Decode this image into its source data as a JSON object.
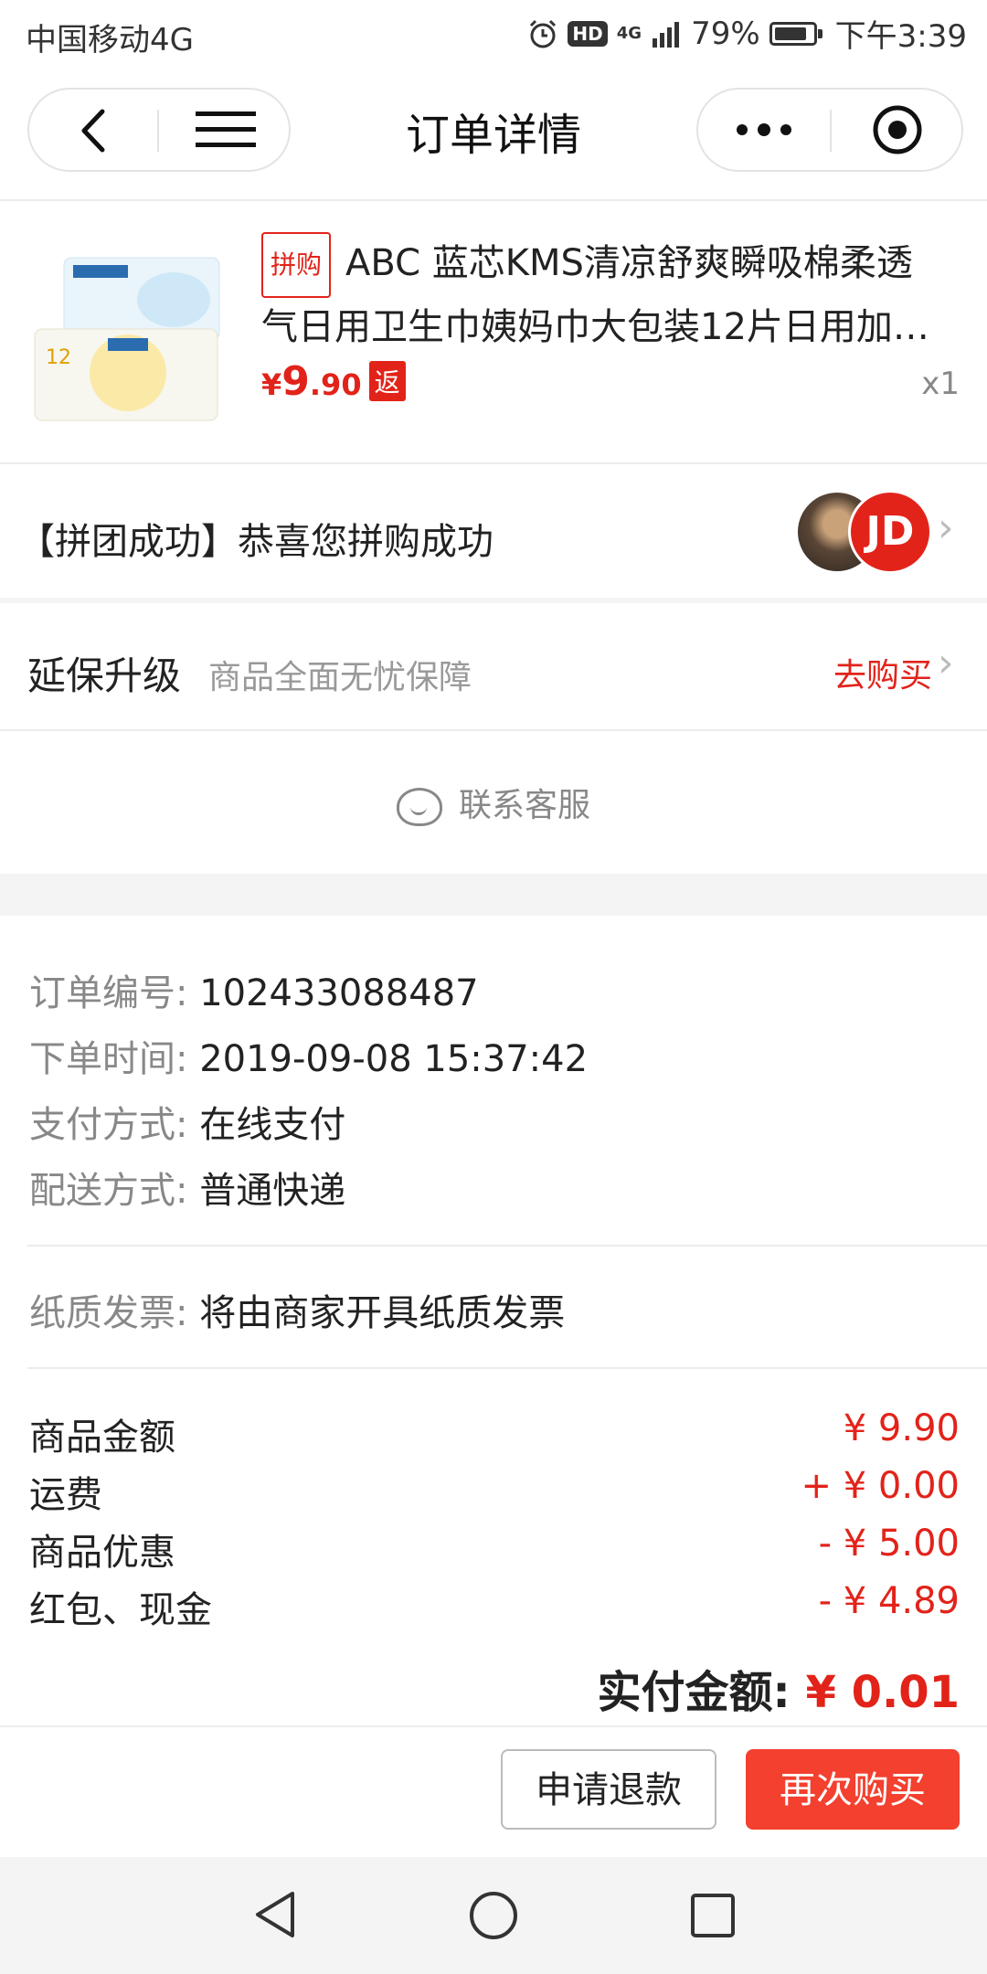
{
  "status_bar": {
    "carrier": "中国移动4G",
    "network": "4G",
    "battery": "79%",
    "time": "下午3:39"
  },
  "nav": {
    "title": "订单详情"
  },
  "product": {
    "tag": "拼购",
    "title_line1": "ABC 蓝芯KMS清凉舒爽瞬吸棉柔透",
    "title_line2": "气日用卫生巾姨妈巾大包装12片日用加…",
    "price_symbol": "¥",
    "price_int": "9",
    "price_dec": ".90",
    "rebate_tag": "返",
    "quantity": "x1"
  },
  "group": {
    "text": "【拼团成功】恭喜您拼购成功",
    "avatar_badge": "JD"
  },
  "service": {
    "title": "延保升级",
    "subtitle": "商品全面无忧保障",
    "buy_label": "去购买"
  },
  "contact": {
    "label": "联系客服"
  },
  "order_info": [
    {
      "label": "订单编号:",
      "value": "102433088487"
    },
    {
      "label": "下单时间:",
      "value": "2019-09-08 15:37:42"
    },
    {
      "label": "支付方式:",
      "value": "在线支付"
    },
    {
      "label": "配送方式:",
      "value": "普通快递"
    }
  ],
  "invoice": {
    "label": "纸质发票:",
    "value": "将由商家开具纸质发票"
  },
  "amounts": [
    {
      "label": "商品金额",
      "value": "¥ 9.90"
    },
    {
      "label": "运费",
      "value": "+ ¥ 0.00"
    },
    {
      "label": "商品优惠",
      "value": "- ¥ 5.00"
    },
    {
      "label": "红包、现金",
      "value": "- ¥ 4.89"
    }
  ],
  "total": {
    "label": "实付金额:",
    "value": "¥ 0.01"
  },
  "actions": {
    "refund": "申请退款",
    "rebuy": "再次购买"
  },
  "colors": {
    "accent": "#e2231a",
    "button": "#f3402f"
  }
}
